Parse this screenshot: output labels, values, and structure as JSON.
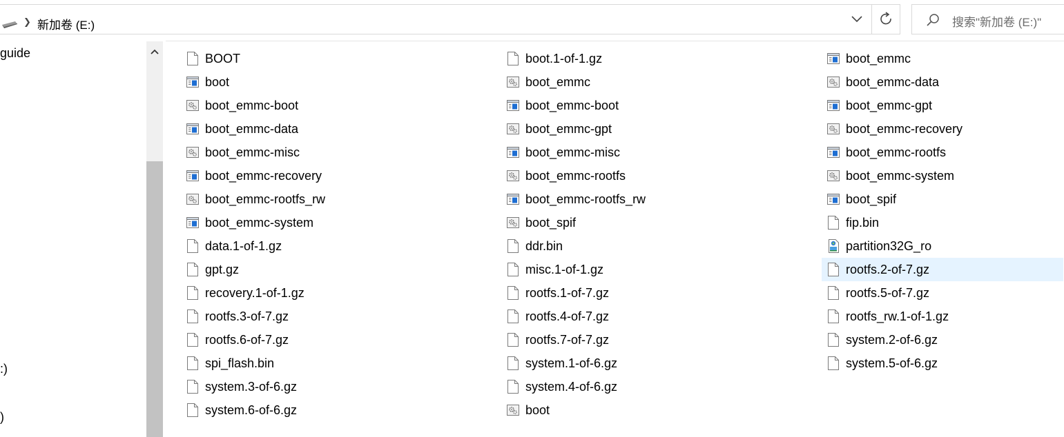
{
  "address_bar": {
    "path_label": "新加卷 (E:)",
    "search_placeholder": "搜索\"新加卷 (E:)\""
  },
  "navigation": {
    "items": [
      "guide",
      ":)",
      ")"
    ]
  },
  "files": [
    {
      "name": "BOOT",
      "type": "blank"
    },
    {
      "name": "boot",
      "type": "window"
    },
    {
      "name": "boot_emmc-boot",
      "type": "gear"
    },
    {
      "name": "boot_emmc-data",
      "type": "window"
    },
    {
      "name": "boot_emmc-misc",
      "type": "gear"
    },
    {
      "name": "boot_emmc-recovery",
      "type": "window"
    },
    {
      "name": "boot_emmc-rootfs_rw",
      "type": "gear"
    },
    {
      "name": "boot_emmc-system",
      "type": "window"
    },
    {
      "name": "data.1-of-1.gz",
      "type": "blank"
    },
    {
      "name": "gpt.gz",
      "type": "blank"
    },
    {
      "name": "recovery.1-of-1.gz",
      "type": "blank"
    },
    {
      "name": "rootfs.3-of-7.gz",
      "type": "blank"
    },
    {
      "name": "rootfs.6-of-7.gz",
      "type": "blank"
    },
    {
      "name": "spi_flash.bin",
      "type": "blank"
    },
    {
      "name": "system.3-of-6.gz",
      "type": "blank"
    },
    {
      "name": "system.6-of-6.gz",
      "type": "blank"
    },
    {
      "name": "boot.1-of-1.gz",
      "type": "blank"
    },
    {
      "name": "boot_emmc",
      "type": "gear"
    },
    {
      "name": "boot_emmc-boot",
      "type": "window"
    },
    {
      "name": "boot_emmc-gpt",
      "type": "gear"
    },
    {
      "name": "boot_emmc-misc",
      "type": "window"
    },
    {
      "name": "boot_emmc-rootfs",
      "type": "gear"
    },
    {
      "name": "boot_emmc-rootfs_rw",
      "type": "window"
    },
    {
      "name": "boot_spif",
      "type": "gear"
    },
    {
      "name": "ddr.bin",
      "type": "blank"
    },
    {
      "name": "misc.1-of-1.gz",
      "type": "blank"
    },
    {
      "name": "rootfs.1-of-7.gz",
      "type": "blank"
    },
    {
      "name": "rootfs.4-of-7.gz",
      "type": "blank"
    },
    {
      "name": "rootfs.7-of-7.gz",
      "type": "blank"
    },
    {
      "name": "system.1-of-6.gz",
      "type": "blank"
    },
    {
      "name": "system.4-of-6.gz",
      "type": "blank"
    },
    {
      "name": "boot",
      "type": "gear"
    },
    {
      "name": "boot_emmc",
      "type": "window"
    },
    {
      "name": "boot_emmc-data",
      "type": "gear"
    },
    {
      "name": "boot_emmc-gpt",
      "type": "window"
    },
    {
      "name": "boot_emmc-recovery",
      "type": "gear"
    },
    {
      "name": "boot_emmc-rootfs",
      "type": "window"
    },
    {
      "name": "boot_emmc-system",
      "type": "gear"
    },
    {
      "name": "boot_spif",
      "type": "window"
    },
    {
      "name": "fip.bin",
      "type": "blank"
    },
    {
      "name": "partition32G_ro",
      "type": "script"
    },
    {
      "name": "rootfs.2-of-7.gz",
      "type": "blank",
      "selected": true
    },
    {
      "name": "rootfs.5-of-7.gz",
      "type": "blank"
    },
    {
      "name": "rootfs_rw.1-of-1.gz",
      "type": "blank"
    },
    {
      "name": "system.2-of-6.gz",
      "type": "blank"
    },
    {
      "name": "system.5-of-6.gz",
      "type": "blank"
    }
  ],
  "colors": {
    "selection": "#e5f3ff",
    "window_icon_blue": "#1e6ed2",
    "scroll_thumb": "#c2c2c2"
  }
}
